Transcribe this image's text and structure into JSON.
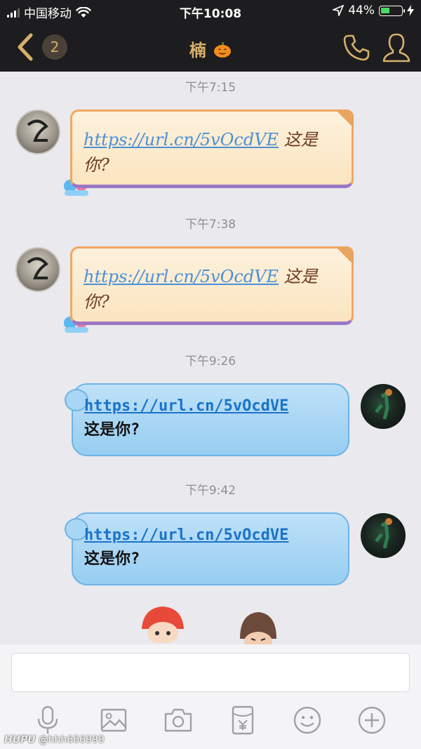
{
  "status_bar": {
    "carrier": "中国移动",
    "time": "下午10:08",
    "battery_percent": "44%",
    "battery_level": 0.44
  },
  "header": {
    "unread_count": "2",
    "contact_name": "楠"
  },
  "messages": [
    {
      "time": "下午7:15",
      "side": "left",
      "link": "https://url.cn/5vOcdVE",
      "text": "这是你?"
    },
    {
      "time": "下午7:38",
      "side": "left",
      "link": "https://url.cn/5vOcdVE",
      "text": "这是你?"
    },
    {
      "time": "下午9:26",
      "side": "right",
      "link": "https://url.cn/5vOcdVE",
      "text": "这是你?"
    },
    {
      "time": "下午9:42",
      "side": "right",
      "link": "https://url.cn/5vOcdVE",
      "text": "这是你?"
    }
  ],
  "toolbar": [
    "mic-icon",
    "image-icon",
    "camera-icon",
    "red-packet-icon",
    "emoji-icon",
    "plus-icon"
  ],
  "watermark": {
    "brand": "HUPU",
    "handle": "@hhh666999"
  },
  "colors": {
    "nav_bg": "#1d1d1f",
    "accent_gold": "#d6b06a",
    "chat_bg": "#e9e9ee",
    "bubble_blue": "#a9d6f4",
    "bubble_orange": "#fbe5c0"
  }
}
